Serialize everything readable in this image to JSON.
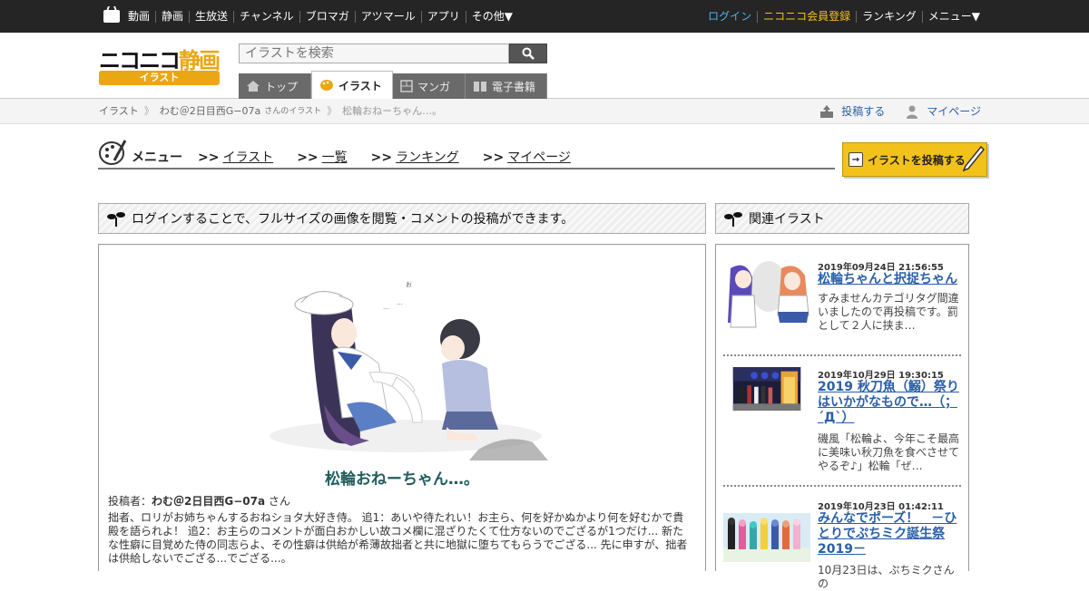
{
  "topbar": {
    "nav": [
      "動画",
      "静画",
      "生放送",
      "チャンネル",
      "ブロマガ",
      "アツマール",
      "アプリ",
      "その他▼"
    ],
    "login": "ログイン",
    "register": "ニコニコ会員登録",
    "ranking": "ランキング",
    "menu": "メニュー▼"
  },
  "header": {
    "logo_main": "ニコニコ",
    "logo_accent": "静画",
    "logo_sub": "イラスト",
    "search_placeholder": "イラストを検索",
    "tabs": [
      "トップ",
      "イラスト",
      "マンガ",
      "電子書籍"
    ]
  },
  "breadcrumb": {
    "root": "イラスト",
    "user": "わむ＠2日目西G−07a",
    "user_suffix": "さんのイラスト",
    "current": "松輪おねーちゃん…。",
    "post_link": "投稿する",
    "mypage_link": "マイページ"
  },
  "menu": {
    "title": "メニュー",
    "links": [
      "イラスト",
      "一覧",
      "ランキング",
      "マイページ"
    ],
    "link_prefix": ">>",
    "post_button": "イラストを投稿する"
  },
  "main": {
    "notice": "ログインすることで、フルサイズの画像を閲覧・コメントの投稿ができます。",
    "title": "松輪おねーちゃん…。",
    "poster_label": "投稿者：",
    "poster_name": "わむ＠2日目西G−07a",
    "poster_suffix": "さん",
    "description": "拙者、ロリがお姉ちゃんするおねショタ大好き侍。 追1：あいや待たれい！お主ら、何を好かぬかより何を好むかで貴殿を語られよ！ 追2：お主らのコメントが面白おかしい故コメ欄に混ざりたくて仕方ないのでござるが1つだけ... 新たな性癖に目覚めた侍の同志らよ、その性癖は供給が希薄故拙者と共に地獄に堕ちてもらうでござる... 先に申すが、拙者は供給しないでござる...でござる...。"
  },
  "related": {
    "title": "関連イラスト",
    "items": [
      {
        "date": "2019年09月24日 21:56:55",
        "title": "松輪ちゃんと択捉ちゃん",
        "text": "すみませんカテゴリタグ間違いましたので再投稿です。罰として２人に挟ま…"
      },
      {
        "date": "2019年10月29日 19:30:15",
        "title": "2019 秋刀魚（鰯）祭りはいかがなもので…（；´Д`）",
        "text": "磯風「松輪よ、今年こそ最高に美味い秋刀魚を食べさせてやるぞ♪」松輪「ぜ…"
      },
      {
        "date": "2019年10月23日 01:42:11",
        "title": "みんなでポーズ！　－ひとりでぷちミク誕生祭2019－",
        "text": "10月23日は、ぷちミクさんの"
      }
    ]
  },
  "colors": {
    "topbar": "#252525",
    "accent": "#e9a713",
    "link": "#2a5fa8",
    "title": "#225c5c"
  }
}
